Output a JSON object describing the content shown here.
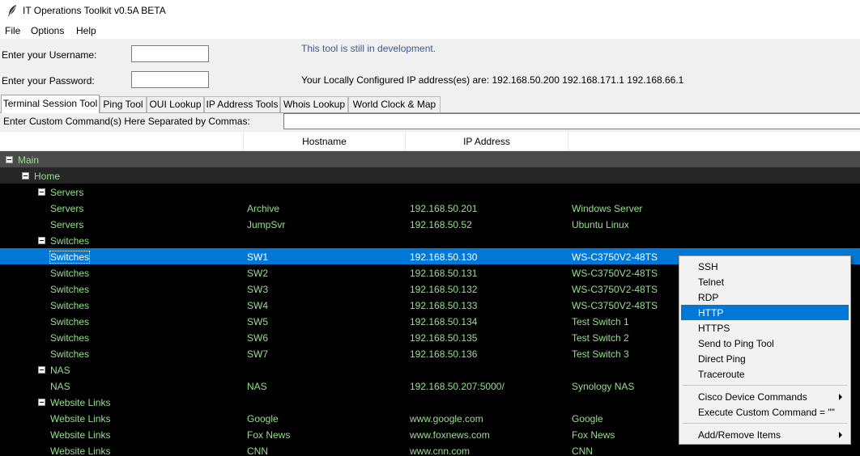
{
  "window": {
    "title": "IT Operations Toolkit v0.5A BETA",
    "icon": "feather-icon"
  },
  "menubar": {
    "items": [
      "File",
      "Options",
      "Help"
    ]
  },
  "form": {
    "username_label": "Enter your Username:",
    "username_value": "",
    "password_label": "Enter your Password:",
    "password_value": "",
    "dev_note": "This tool is still in development.",
    "ip_line": "Your Locally Configured IP address(es) are: 192.168.50.200 192.168.171.1 192.168.66.1"
  },
  "tabs": [
    "Terminal Session Tool",
    "Ping Tool",
    "OUI Lookup",
    "IP Address Tools",
    "Whois Lookup",
    "World Clock & Map"
  ],
  "active_tab": "Terminal Session Tool",
  "custom_command": {
    "label": "Enter Custom Command(s) Here Separated by Commas:",
    "value": ""
  },
  "tree": {
    "columns": [
      "",
      "Hostname",
      "IP Address",
      ""
    ],
    "rows": [
      {
        "depth": 0,
        "expander": true,
        "c0": "Main",
        "c1": "",
        "c2": "",
        "c3": ""
      },
      {
        "depth": 1,
        "expander": true,
        "c0": "Home",
        "c1": "",
        "c2": "",
        "c3": ""
      },
      {
        "depth": 2,
        "expander": true,
        "c0": "Servers",
        "c1": "",
        "c2": "",
        "c3": ""
      },
      {
        "depth": 3,
        "expander": false,
        "c0": "Servers",
        "c1": "Archive",
        "c2": "192.168.50.201",
        "c3": "Windows Server"
      },
      {
        "depth": 3,
        "expander": false,
        "c0": "Servers",
        "c1": "JumpSvr",
        "c2": "192.168.50.52",
        "c3": "Ubuntu Linux"
      },
      {
        "depth": 2,
        "expander": true,
        "c0": "Switches",
        "c1": "",
        "c2": "",
        "c3": ""
      },
      {
        "depth": 3,
        "expander": false,
        "selected": true,
        "c0": "Switches",
        "c1": "SW1",
        "c2": "192.168.50.130",
        "c3": "WS-C3750V2-48TS"
      },
      {
        "depth": 3,
        "expander": false,
        "c0": "Switches",
        "c1": "SW2",
        "c2": "192.168.50.131",
        "c3": "WS-C3750V2-48TS"
      },
      {
        "depth": 3,
        "expander": false,
        "c0": "Switches",
        "c1": "SW3",
        "c2": "192.168.50.132",
        "c3": "WS-C3750V2-48TS"
      },
      {
        "depth": 3,
        "expander": false,
        "c0": "Switches",
        "c1": "SW4",
        "c2": "192.168.50.133",
        "c3": "WS-C3750V2-48TS"
      },
      {
        "depth": 3,
        "expander": false,
        "c0": "Switches",
        "c1": "SW5",
        "c2": "192.168.50.134",
        "c3": "Test Switch 1"
      },
      {
        "depth": 3,
        "expander": false,
        "c0": "Switches",
        "c1": "SW6",
        "c2": "192.168.50.135",
        "c3": "Test Switch 2"
      },
      {
        "depth": 3,
        "expander": false,
        "c0": "Switches",
        "c1": "SW7",
        "c2": "192.168.50.136",
        "c3": "Test Switch 3"
      },
      {
        "depth": 2,
        "expander": true,
        "c0": "NAS",
        "c1": "",
        "c2": "",
        "c3": ""
      },
      {
        "depth": 3,
        "expander": false,
        "c0": "NAS",
        "c1": "NAS",
        "c2": "192.168.50.207:5000/",
        "c3": "Synology NAS"
      },
      {
        "depth": 2,
        "expander": true,
        "c0": "Website Links",
        "c1": "",
        "c2": "",
        "c3": ""
      },
      {
        "depth": 3,
        "expander": false,
        "c0": "Website Links",
        "c1": "Google",
        "c2": "www.google.com",
        "c3": "Google"
      },
      {
        "depth": 3,
        "expander": false,
        "c0": "Website Links",
        "c1": "Fox News",
        "c2": "www.foxnews.com",
        "c3": "Fox News"
      },
      {
        "depth": 3,
        "expander": false,
        "c0": "Website Links",
        "c1": "CNN",
        "c2": "www.cnn.com",
        "c3": "CNN"
      }
    ]
  },
  "context_menu": {
    "items": [
      {
        "label": "SSH"
      },
      {
        "label": "Telnet"
      },
      {
        "label": "RDP"
      },
      {
        "label": "HTTP",
        "active": true
      },
      {
        "label": "HTTPS"
      },
      {
        "label": "Send to Ping Tool"
      },
      {
        "label": "Direct Ping"
      },
      {
        "label": "Traceroute"
      },
      {
        "separator": true
      },
      {
        "label": "Cisco Device Commands",
        "submenu": true
      },
      {
        "label": "Execute Custom Command = \"\""
      },
      {
        "separator": true
      },
      {
        "label": "Add/Remove Items",
        "submenu": true
      }
    ]
  },
  "colors": {
    "tree_text": "#96e08c",
    "selection": "#0078d7",
    "tree_bg": "#000000",
    "dev_note": "#3c5a8c"
  }
}
